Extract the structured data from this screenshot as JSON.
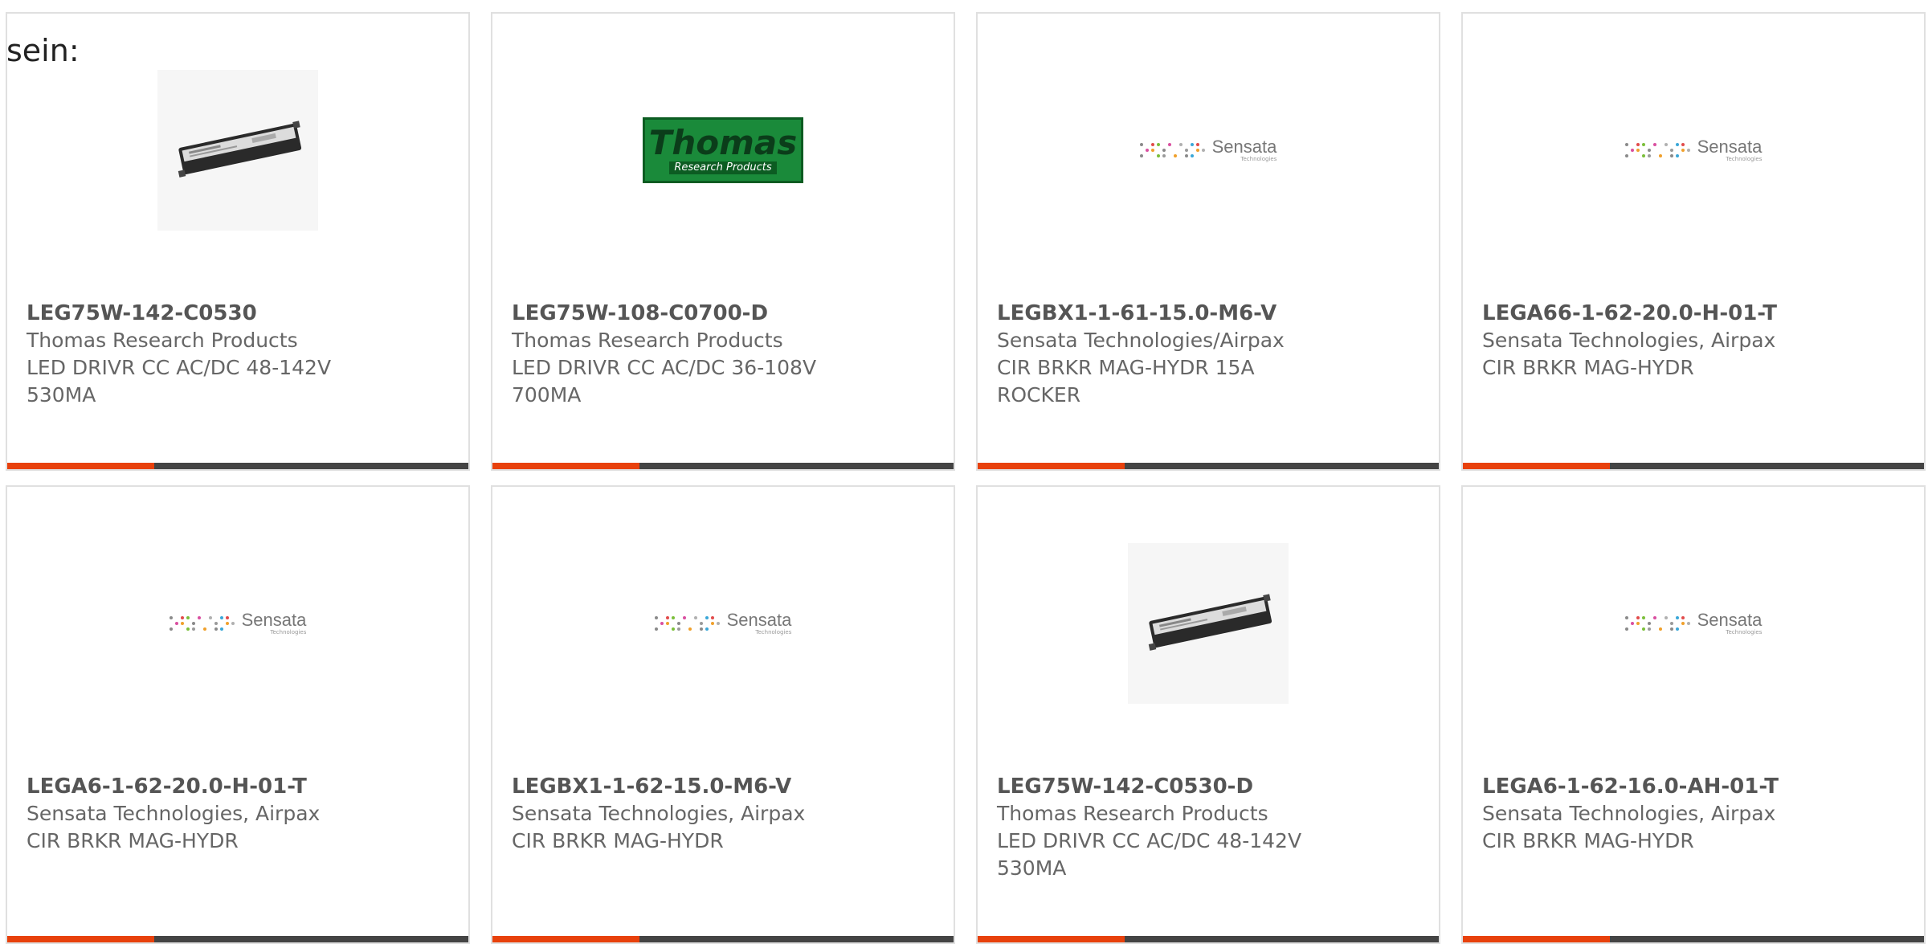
{
  "intro_text": "sein:",
  "colors": {
    "accent": "#e8410c",
    "bar": "#444444",
    "border": "#e0e0e0"
  },
  "products": [
    {
      "part": "LEG75W-142-C0530",
      "manufacturer": "Thomas Research Products",
      "description": "LED DRIVR CC AC/DC 48-142V 530MA",
      "image": "led-driver"
    },
    {
      "part": "LEG75W-108-C0700-D",
      "manufacturer": "Thomas Research Products",
      "description": "LED DRIVR CC AC/DC 36-108V 700MA",
      "image": "thomas-logo"
    },
    {
      "part": "LEGBX1-1-61-15.0-M6-V",
      "manufacturer": "Sensata Technologies/Airpax",
      "description": "CIR BRKR MAG-HYDR 15A ROCKER",
      "image": "sensata-logo"
    },
    {
      "part": "LEGA66-1-62-20.0-H-01-T",
      "manufacturer": "Sensata Technologies, Airpax",
      "description": "CIR BRKR MAG-HYDR",
      "image": "sensata-logo"
    },
    {
      "part": "LEGA6-1-62-20.0-H-01-T",
      "manufacturer": "Sensata Technologies, Airpax",
      "description": "CIR BRKR MAG-HYDR",
      "image": "sensata-logo"
    },
    {
      "part": "LEGBX1-1-62-15.0-M6-V",
      "manufacturer": "Sensata Technologies, Airpax",
      "description": "CIR BRKR MAG-HYDR",
      "image": "sensata-logo"
    },
    {
      "part": "LEG75W-142-C0530-D",
      "manufacturer": "Thomas Research Products",
      "description": "LED DRIVR CC AC/DC 48-142V 530MA",
      "image": "led-driver"
    },
    {
      "part": "LEGA6-1-62-16.0-AH-01-T",
      "manufacturer": "Sensata Technologies, Airpax",
      "description": "CIR BRKR MAG-HYDR",
      "image": "sensata-logo"
    }
  ],
  "logos": {
    "thomas_big": "Thomas",
    "thomas_small": "Research Products",
    "sensata_name": "Sensata",
    "sensata_sub": "Technologies"
  }
}
